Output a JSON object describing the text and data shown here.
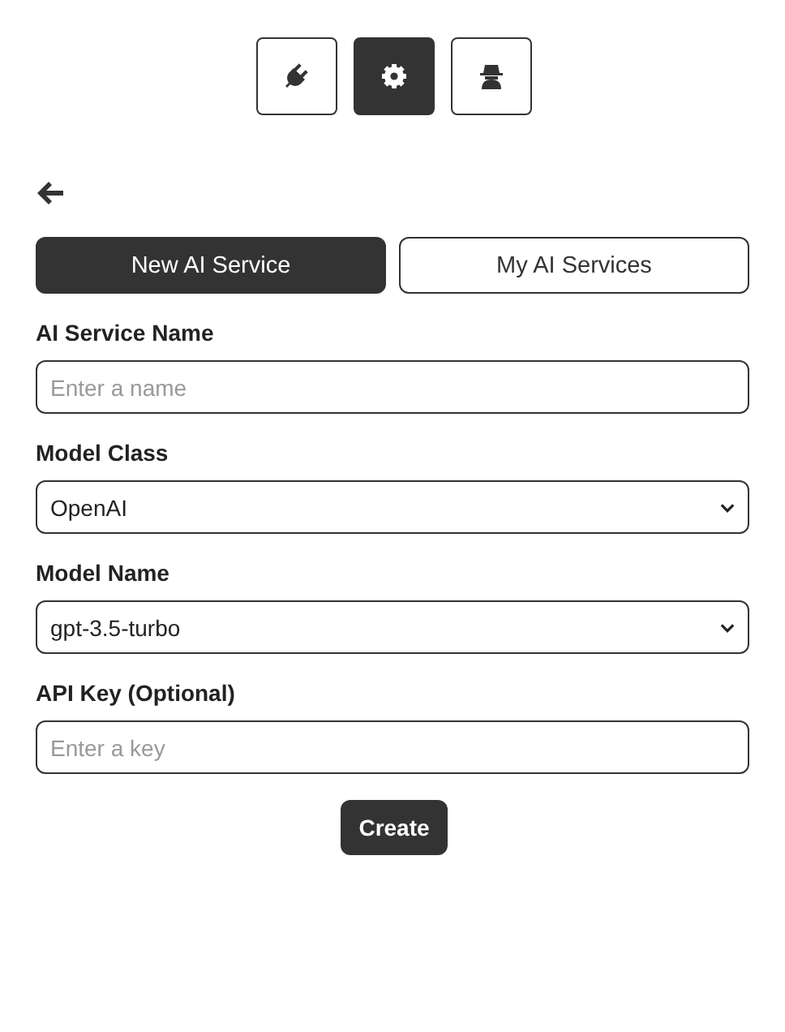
{
  "nav_buttons": [
    {
      "kind": "plug",
      "selected": false
    },
    {
      "kind": "gear",
      "selected": true
    },
    {
      "kind": "spy",
      "selected": false
    }
  ],
  "tabs": [
    {
      "label": "New AI Service",
      "selected": true
    },
    {
      "label": "My AI Services",
      "selected": false
    }
  ],
  "fields": [
    {
      "kind": "input",
      "label": "AI Service Name",
      "placeholder": "Enter a name"
    },
    {
      "kind": "select",
      "label": "Model Class",
      "value": "OpenAI"
    },
    {
      "kind": "select",
      "label": "Model Name",
      "value": "gpt-3.5-turbo"
    },
    {
      "kind": "input",
      "label": "API Key (Optional)",
      "placeholder": "Enter a key"
    }
  ],
  "submit": "Create"
}
